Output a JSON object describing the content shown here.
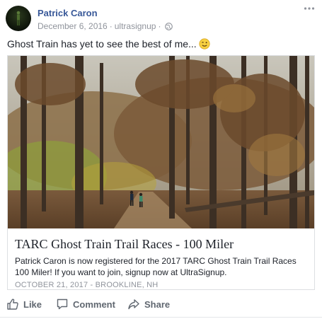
{
  "post": {
    "author": "Patrick Caron",
    "date": "December 6, 2016",
    "source": "ultrasignup",
    "separator": "·",
    "status_text": "Ghost Train has yet to see the best of me...",
    "emoji": "wink-face"
  },
  "link_card": {
    "title": "TARC Ghost Train Trail Races - 100 Miler",
    "description": "Patrick Caron is now registered for the 2017 TARC Ghost Train Trail Races 100 Miler! If you want to join, signup now at UltraSignup.",
    "source_line": "OCTOBER 21, 2017 - BROOKLINE, NH"
  },
  "actions": {
    "like": "Like",
    "comment": "Comment",
    "share": "Share"
  },
  "colors": {
    "author": "#385898",
    "meta": "#90949c",
    "action": "#606770"
  },
  "icons": [
    "more-options-icon",
    "globe-icon",
    "wink-emoji-icon",
    "like-icon",
    "comment-icon",
    "share-icon"
  ]
}
